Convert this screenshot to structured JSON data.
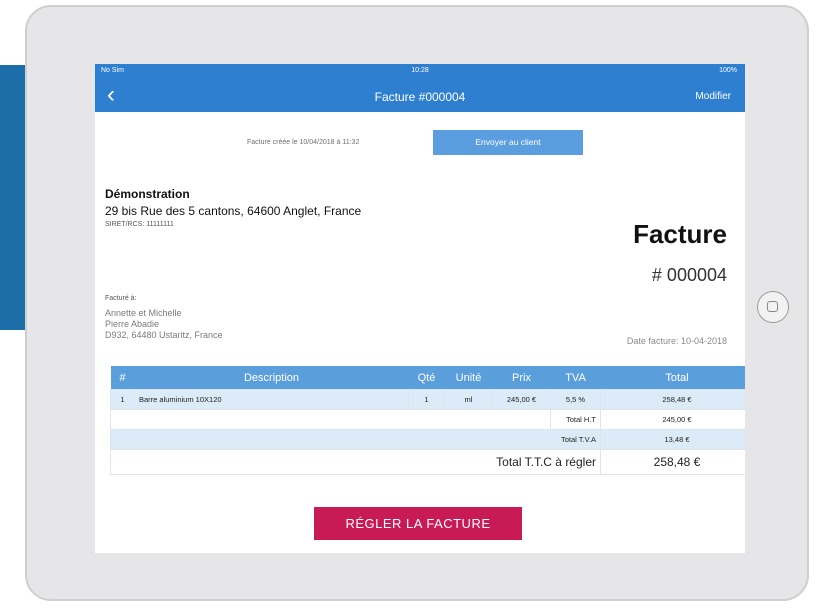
{
  "status_bar": {
    "carrier": "No Sim",
    "time": "10:28",
    "battery": "100%"
  },
  "nav": {
    "back_glyph": "‹",
    "title": "Facture #000004",
    "edit_label": "Modifier"
  },
  "invoice_meta": {
    "created_text": "Facture créée le 10/04/2018 à 11:32",
    "send_button_label": "Envoyer au client"
  },
  "company": {
    "name": "Démonstration",
    "address": "29 bis Rue des 5 cantons, 64600 Anglet, France",
    "siret": "SIRET/RCS: 11111111"
  },
  "invoice": {
    "title": "Facture",
    "number": "# 000004",
    "date_label": "Date facture: 10-04-2018"
  },
  "client": {
    "header": "Facturé à:",
    "line1": "Annette et Michelle",
    "line2": "Pierre Abadie",
    "line3": "D932, 64480 Ustaritz, France"
  },
  "table": {
    "headers": [
      "#",
      "Description",
      "Qté",
      "Unité",
      "Prix",
      "TVA",
      "Total"
    ],
    "rows": [
      {
        "num": "1",
        "description": "Barre aluminium 10X120",
        "qty": "1",
        "unit": "ml",
        "price": "245,00 €",
        "tva": "5,5 %",
        "total": "258,48 €"
      }
    ],
    "total_ht_label": "Total H.T",
    "total_ht_value": "245,00 €",
    "total_tva_label": "Total T.V.A",
    "total_tva_value": "13,48 €",
    "total_ttc_label": "Total T.T.C à régler",
    "total_ttc_value": "258,48 €"
  },
  "pay_button_label": "RÉGLER LA FACTURE",
  "colors": {
    "nav_blue": "#2e7fcf",
    "table_header_blue": "#5a9fdc",
    "row_blue": "#dcebf8",
    "pay_button": "#c81a55",
    "side_band": "#1b6ea8"
  }
}
